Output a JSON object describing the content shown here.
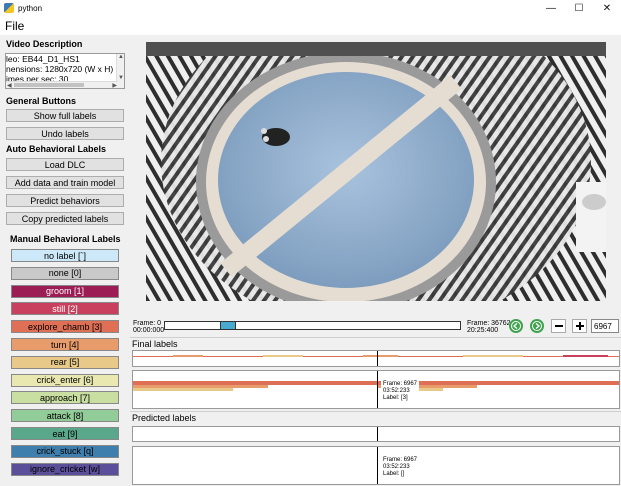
{
  "window": {
    "title": "python",
    "minimize": "—",
    "maximize": "☐",
    "close": "✕"
  },
  "menu": {
    "file": "File"
  },
  "video_description": {
    "heading": "Video Description",
    "lines": [
      "leo: EB44_D1_HS1",
      "nensions: 1280x720 (W x H)",
      "imes per sec: 30"
    ]
  },
  "general_buttons": {
    "heading": "General Buttons",
    "show_full_labels": "Show full labels",
    "undo_labels": "Undo labels"
  },
  "auto_labels": {
    "heading": "Auto Behavioral Labels",
    "load_dlc": "Load DLC",
    "add_data_train": "Add data and train model",
    "predict": "Predict behaviors",
    "copy_predicted": "Copy predicted labels"
  },
  "manual_labels": {
    "heading": "Manual Behavioral Labels",
    "items": [
      {
        "label": "no label [`]",
        "color": "#cde8f9",
        "text_color": "#000000"
      },
      {
        "label": "none [0]",
        "color": "#c9c9c9",
        "text_color": "#000000"
      },
      {
        "label": "groom [1]",
        "color": "#9b1d53",
        "text_color": "#ffffff"
      },
      {
        "label": "still [2]",
        "color": "#c8405d",
        "text_color": "#ffffff"
      },
      {
        "label": "explore_chamb [3]",
        "color": "#e07055",
        "text_color": "#000000"
      },
      {
        "label": "turn [4]",
        "color": "#e89c6b",
        "text_color": "#000000"
      },
      {
        "label": "rear [5]",
        "color": "#e8c98a",
        "text_color": "#000000"
      },
      {
        "label": "crick_enter [6]",
        "color": "#e9e8b0",
        "text_color": "#000000"
      },
      {
        "label": "approach [7]",
        "color": "#c9dea1",
        "text_color": "#000000"
      },
      {
        "label": "attack [8]",
        "color": "#92cc98",
        "text_color": "#000000"
      },
      {
        "label": "eat [9]",
        "color": "#5aa88c",
        "text_color": "#000000"
      },
      {
        "label": "crick_stuck [q]",
        "color": "#3f7fae",
        "text_color": "#000000"
      },
      {
        "label": "ignore_cricket [w]",
        "color": "#5c4f9a",
        "text_color": "#000000"
      }
    ]
  },
  "controls": {
    "start_frame": "Frame: 0",
    "start_time": "00:00:000",
    "end_frame": "Frame: 36762",
    "end_time": "20:25:400",
    "current_frame": "6967",
    "slider_position": 0.19
  },
  "final_labels": {
    "heading": "Final labels",
    "info_frame": "Frame: 6967",
    "info_time": "03:52:233",
    "info_label": "Label: [3]"
  },
  "predicted_labels": {
    "heading": "Predicted labels",
    "info_frame": "Frame: 6967",
    "info_time": "03:52:233",
    "info_label": "Label: []"
  }
}
